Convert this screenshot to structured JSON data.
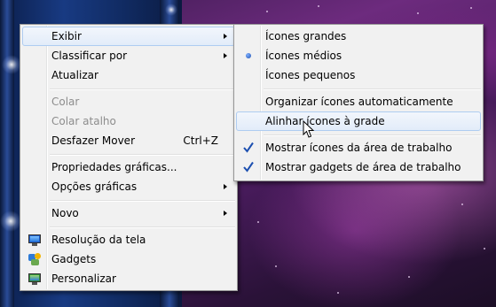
{
  "context_menu": {
    "items": [
      {
        "label": "Exibir",
        "submenu": true,
        "highlighted": true
      },
      {
        "label": "Classificar por",
        "submenu": true
      },
      {
        "label": "Atualizar"
      },
      {
        "label": "Colar",
        "disabled": true
      },
      {
        "label": "Colar atalho",
        "disabled": true
      },
      {
        "label": "Desfazer Mover",
        "shortcut": "Ctrl+Z"
      },
      {
        "label": "Propriedades gráficas..."
      },
      {
        "label": "Opções gráficas",
        "submenu": true
      },
      {
        "label": "Novo",
        "submenu": true
      },
      {
        "label": "Resolução da tela",
        "icon": "display-settings-icon"
      },
      {
        "label": "Gadgets",
        "icon": "gadgets-icon"
      },
      {
        "label": "Personalizar",
        "icon": "personalize-icon"
      }
    ]
  },
  "view_submenu": {
    "items": [
      {
        "label": "Ícones grandes"
      },
      {
        "label": "Ícones médios",
        "selected": true,
        "indicator": "radio-bullet"
      },
      {
        "label": "Ícones pequenos"
      },
      {
        "label": "Organizar ícones automaticamente"
      },
      {
        "label": "Alinhar ícones à grade",
        "highlighted": true
      },
      {
        "label": "Mostrar ícones da área de trabalho",
        "checked": true
      },
      {
        "label": "Mostrar gadgets de área de trabalho",
        "checked": true
      }
    ]
  },
  "colors": {
    "menu_background": "#f1f1f1",
    "highlight_border": "#aeccf1",
    "disabled_text": "#8d8d8d",
    "check_color": "#1c4fb0"
  }
}
